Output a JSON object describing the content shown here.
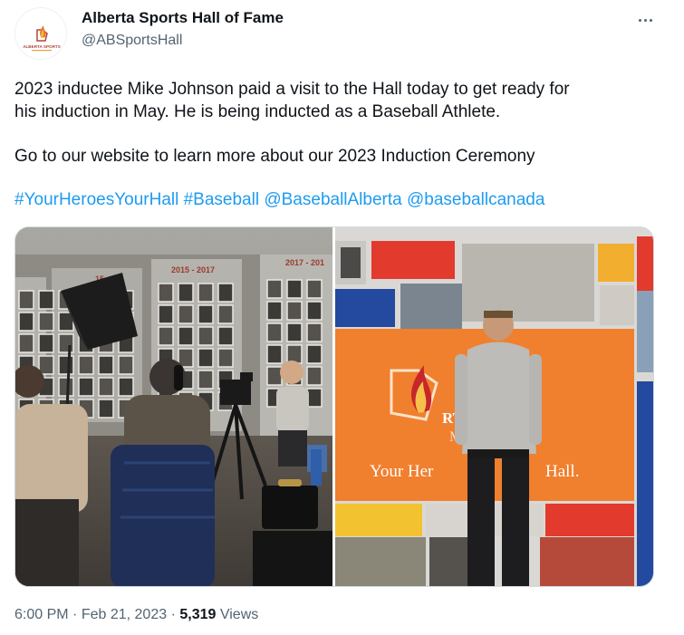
{
  "account": {
    "name": "Alberta Sports Hall of Fame",
    "handle": "@ABSportsHall",
    "avatar_text": "ALBERTA SPORTS"
  },
  "tweet": {
    "line1": "2023 inductee Mike Johnson paid a visit to the Hall today to get ready for",
    "line2": "his induction in May. He is being inducted as a Baseball Athlete.",
    "line3": "Go to our website to learn more about our 2023 Induction Ceremony",
    "hashtags": [
      "#YourHeroesYourHall",
      "#Baseball",
      "@BaseballAlberta",
      "@baseballcanada"
    ]
  },
  "media": {
    "left_photo": {
      "plaque_labels": [
        "15",
        "2015 - 2017",
        "2017 - 201"
      ]
    },
    "right_photo": {
      "banner_text_1": "RTS",
      "banner_text_2": "ME",
      "banner_slogan_left": "Your Her",
      "banner_slogan_right": "Hall."
    }
  },
  "footer": {
    "time": "6:00 PM",
    "date": "Feb 21, 2023",
    "views_count": "5,319",
    "views_label": "Views"
  },
  "colors": {
    "link": "#1d9bf0",
    "secondary_text": "#536471",
    "banner_orange": "#f07f2e"
  }
}
